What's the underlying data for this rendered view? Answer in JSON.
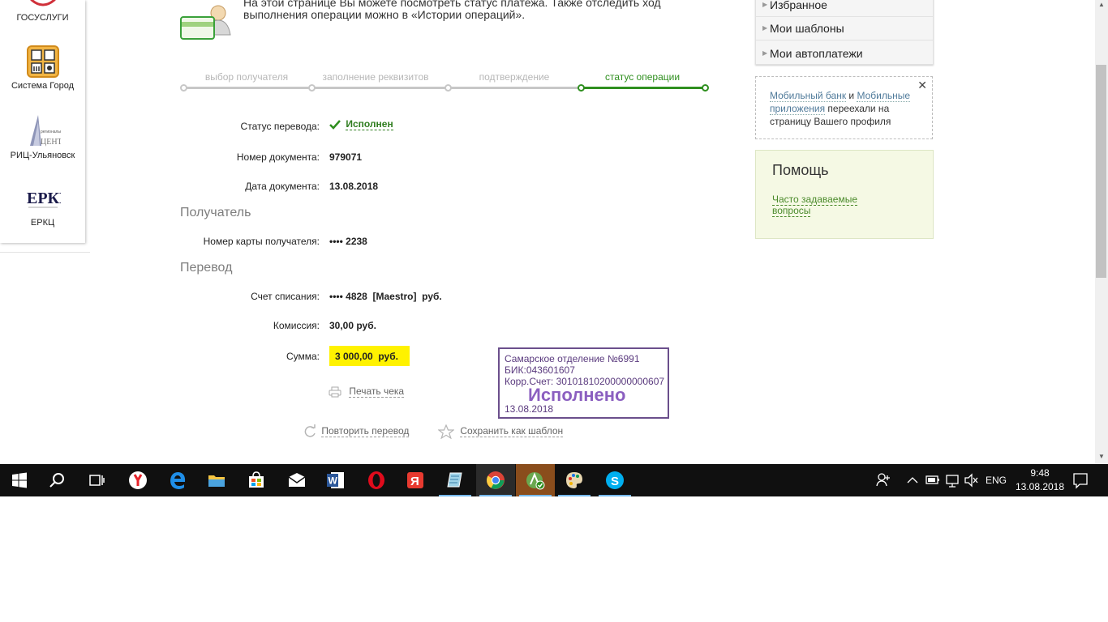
{
  "left_services": [
    {
      "label": "ГОСУСЛУГИ"
    },
    {
      "label": "Система Город"
    },
    {
      "label": "РИЦ-Ульяновск",
      "logo_caption": "ЦЕНТР"
    },
    {
      "label": "ЕРКЦ",
      "logo_text": "ЕРКЦ"
    }
  ],
  "intro_text": "На этой странице Вы можете посмотреть статус платежа. Также отследить ход выполнения операции можно в «Истории операций».",
  "steps": [
    {
      "label": "выбор получателя",
      "active": false
    },
    {
      "label": "заполнение реквизитов",
      "active": false
    },
    {
      "label": "подтверждение",
      "active": false
    },
    {
      "label": "статус операции",
      "active": true
    }
  ],
  "details": {
    "status_label": "Статус перевода:",
    "status_value": "Исполнен",
    "doc_number_label": "Номер документа:",
    "doc_number_value": "979071",
    "doc_date_label": "Дата документа:",
    "doc_date_value": "13.08.2018",
    "recipient_section": "Получатель",
    "card_label": "Номер карты получателя:",
    "card_value": "•••• 2238",
    "transfer_section": "Перевод",
    "account_label": "Счет списания:",
    "account_value": "•••• 4828  [Maestro]  руб.",
    "fee_label": "Комиссия:",
    "fee_value": "30,00 руб.",
    "sum_label": "Сумма:",
    "sum_value": "3 000,00  руб."
  },
  "actions": {
    "print_receipt": "Печать чека",
    "repeat_transfer": "Повторить перевод",
    "save_template": "Сохранить как шаблон"
  },
  "stamp": {
    "line1": "Самарское отделение №6991",
    "line2": "БИК:043601607",
    "line3": "Корр.Счет: 30101810200000000607",
    "status": "Исполнено",
    "date": "13.08.2018"
  },
  "right_menu": [
    {
      "label": "Избранное"
    },
    {
      "label": "Мои шаблоны"
    },
    {
      "label": "Мои автоплатежи"
    }
  ],
  "notice": {
    "link1": "Мобильный банк",
    "and": " и ",
    "link2": "Мобильные приложения",
    "rest": " переехали на страницу Вашего профиля"
  },
  "help": {
    "title": "Помощь",
    "faq": "Часто задаваемые вопросы"
  },
  "taskbar": {
    "apps": [
      "start",
      "search",
      "task-view",
      "yandex-browser",
      "edge",
      "file-explorer",
      "store",
      "mail",
      "word",
      "opera",
      "yandex",
      "notes",
      "chrome",
      "vpn",
      "paint",
      "skype"
    ],
    "language": "ENG",
    "time": "9:48",
    "date": "13.08.2018"
  },
  "colors": {
    "accent_green": "#2f8f1f",
    "sum_highlight": "#fff200",
    "stamp_purple": "#6b4f8c"
  }
}
